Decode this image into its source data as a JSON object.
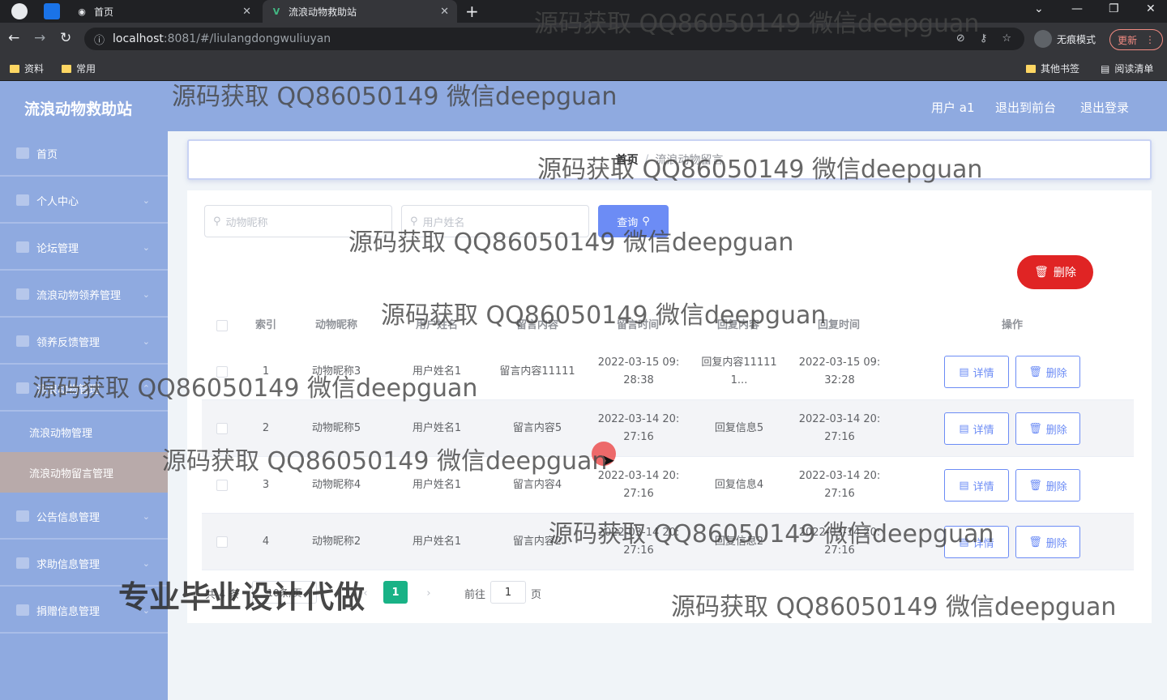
{
  "browser": {
    "tabs": [
      {
        "title": "首页"
      },
      {
        "title": "流浪动物救助站"
      }
    ],
    "new_tab_symbol": "+",
    "url_host": "localhost",
    "url_path": ":8081/#/liulangdongwuliuyan",
    "incognito_label": "无痕模式",
    "update_label": "更新",
    "bookmarks": [
      "资料",
      "常用"
    ],
    "other_bookmarks": "其他书签",
    "reading_list": "阅读清单"
  },
  "app": {
    "title": "流浪动物救助站",
    "user_label": "用户 a1",
    "back_to_front": "退出到前台",
    "logout": "退出登录"
  },
  "sidebar": {
    "items": [
      {
        "label": "首页"
      },
      {
        "label": "个人中心"
      },
      {
        "label": "论坛管理"
      },
      {
        "label": "流浪动物领养管理"
      },
      {
        "label": "领养反馈管理"
      },
      {
        "label": "流浪动物管理"
      }
    ],
    "sub_items": [
      {
        "label": "流浪动物管理"
      },
      {
        "label": "流浪动物留言管理"
      }
    ],
    "bottom_items": [
      {
        "label": "公告信息管理"
      },
      {
        "label": "求助信息管理"
      },
      {
        "label": "捐赠信息管理"
      }
    ]
  },
  "breadcrumb": {
    "home": "首页",
    "separator": "/",
    "current": "流浪动物留言"
  },
  "search": {
    "animal_placeholder": "动物昵称",
    "user_placeholder": "用户姓名",
    "query_label": "查询"
  },
  "delete_label": "删除",
  "table": {
    "headers": [
      "索引",
      "动物昵称",
      "用户姓名",
      "留言内容",
      "留言时间",
      "回复内容",
      "回复时间",
      "操作"
    ],
    "rows": [
      {
        "index": "1",
        "animal": "动物昵称3",
        "user": "用户姓名1",
        "content": "留言内容11111",
        "time1": "2022-03-15 09:",
        "time2": "28:38",
        "reply1": "回复内容11111",
        "reply2": "1...",
        "rtime1": "2022-03-15 09:",
        "rtime2": "32:28"
      },
      {
        "index": "2",
        "animal": "动物昵称5",
        "user": "用户姓名1",
        "content": "留言内容5",
        "time1": "2022-03-14 20:",
        "time2": "27:16",
        "reply1": "回复信息5",
        "reply2": "",
        "rtime1": "2022-03-14 20:",
        "rtime2": "27:16"
      },
      {
        "index": "3",
        "animal": "动物昵称4",
        "user": "用户姓名1",
        "content": "留言内容4",
        "time1": "2022-03-14 20:",
        "time2": "27:16",
        "reply1": "回复信息4",
        "reply2": "",
        "rtime1": "2022-03-14 20:",
        "rtime2": "27:16"
      },
      {
        "index": "4",
        "animal": "动物昵称2",
        "user": "用户姓名1",
        "content": "留言内容2",
        "time1": "2022-03-14 20:",
        "time2": "27:16",
        "reply1": "回复信息2",
        "reply2": "",
        "rtime1": "2022-03-14 20:",
        "rtime2": "27:16"
      }
    ],
    "detail_label": "详情",
    "delete_label": "删除"
  },
  "pagination": {
    "total": "共 4 条",
    "page_size": "10条/页",
    "current_page": "1",
    "goto_label": "前往",
    "goto_value": "1",
    "page_unit": "页"
  },
  "watermark": {
    "text": "源码获取 QQ86050149 微信deepguan",
    "banner": "专业毕业设计代做"
  },
  "colors": {
    "header_bg": "#8faae0",
    "primary": "#6c8cf5",
    "danger": "#e02424",
    "pager_active": "#19b286"
  }
}
